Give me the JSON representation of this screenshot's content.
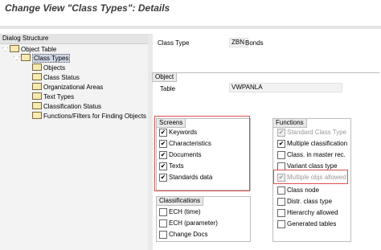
{
  "page": {
    "title": "Change View \"Class Types\": Details"
  },
  "tree": {
    "header": "Dialog Structure",
    "root": "Object Table",
    "selected": "Class Types",
    "children": [
      "Objects",
      "Class Status",
      "Organizational Areas",
      "Text Types",
      "Classification Status",
      "Functions/Filters for Finding Objects"
    ]
  },
  "class_type": {
    "label": "Class Type",
    "code": "ZBN",
    "desc": "Bonds"
  },
  "object": {
    "title": "Object",
    "table_label": "Table",
    "table_value": "VWPANLA"
  },
  "screens": {
    "title": "Screens",
    "items": [
      {
        "label": "Keywords",
        "checked": true
      },
      {
        "label": "Characteristics",
        "checked": true
      },
      {
        "label": "Documents",
        "checked": true
      },
      {
        "label": "Texts",
        "checked": true
      },
      {
        "label": "Standards data",
        "checked": true
      }
    ]
  },
  "classifications": {
    "title": "Classifications",
    "items": [
      {
        "label": "ECH (time)",
        "checked": false
      },
      {
        "label": "ECH (parameter)",
        "checked": false
      },
      {
        "label": "Change Docs",
        "checked": false
      }
    ]
  },
  "functions": {
    "title": "Functions",
    "items": [
      {
        "label": "Standard Class Type",
        "checked": true,
        "disabled": true
      },
      {
        "label": "Multiple classification",
        "checked": true,
        "disabled": false
      },
      {
        "label": "Class. in master rec.",
        "checked": false,
        "disabled": false
      },
      {
        "label": "Variant class type",
        "checked": false,
        "disabled": false
      },
      {
        "label": "Multiple objs allowed",
        "checked": true,
        "disabled": true
      },
      {
        "label": "Class node",
        "checked": false,
        "disabled": false
      },
      {
        "label": "Distr. class type",
        "checked": false,
        "disabled": false
      },
      {
        "label": "Hierarchy allowed",
        "checked": false,
        "disabled": false
      },
      {
        "label": "Generated tables",
        "checked": false,
        "disabled": false
      }
    ]
  },
  "colors": {
    "highlight": "#d9534f",
    "selected_bg": "#cfd7e6"
  }
}
